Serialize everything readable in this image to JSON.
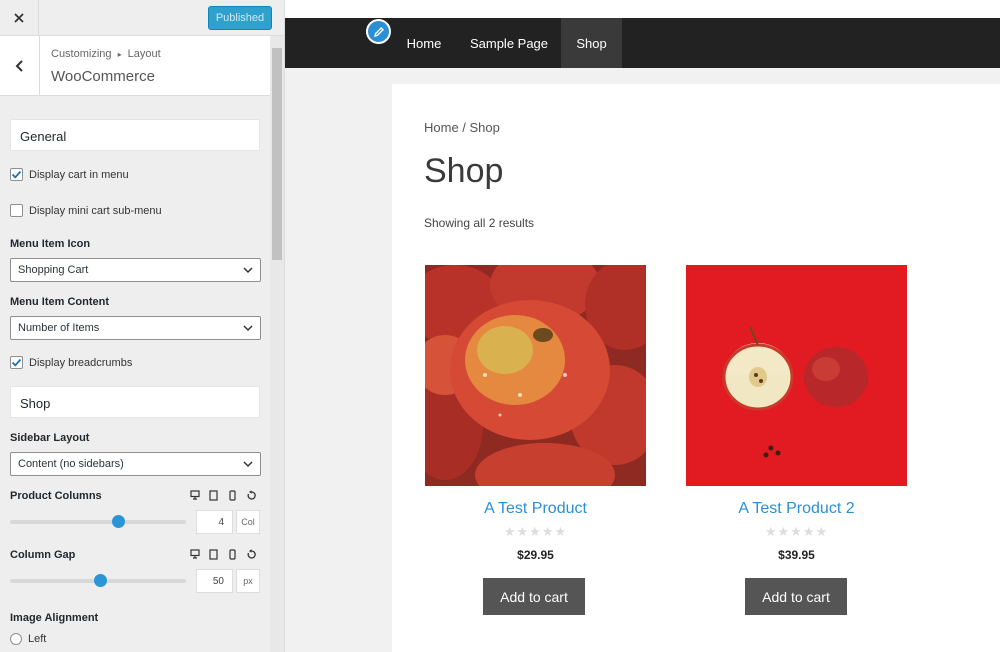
{
  "topbar": {
    "close_icon": "close-icon",
    "publish_label": "Published"
  },
  "section": {
    "breadcrumb_root": "Customizing",
    "breadcrumb_sep": "▸",
    "breadcrumb_parent": "Layout",
    "title": "WooCommerce"
  },
  "general": {
    "heading": "General",
    "display_cart_label": "Display cart in menu",
    "display_cart_checked": true,
    "mini_cart_label": "Display mini cart sub-menu",
    "mini_cart_checked": false,
    "menu_icon_label": "Menu Item Icon",
    "menu_icon_value": "Shopping Cart",
    "menu_content_label": "Menu Item Content",
    "menu_content_value": "Number of Items",
    "breadcrumbs_label": "Display breadcrumbs",
    "breadcrumbs_checked": true
  },
  "shop": {
    "heading": "Shop",
    "sidebar_layout_label": "Sidebar Layout",
    "sidebar_layout_value": "Content (no sidebars)",
    "product_columns_label": "Product Columns",
    "product_columns_value": "4",
    "product_columns_unit": "Col",
    "column_gap_label": "Column Gap",
    "column_gap_value": "50",
    "column_gap_unit": "px",
    "image_alignment_label": "Image Alignment",
    "image_alignment_option_left": "Left"
  },
  "colors": {
    "accent": "#2a8fd4",
    "nav_bg": "#222222",
    "button_bg": "#555555",
    "publish_bg": "#2ea2cc"
  },
  "nav": {
    "items": [
      "Home",
      "Sample Page",
      "Shop"
    ],
    "active": "Shop"
  },
  "page": {
    "breadcrumb": "Home / Shop",
    "title": "Shop",
    "result_count": "Showing all 2 results"
  },
  "products": [
    {
      "name": "A Test Product",
      "price": "$29.95",
      "rating_stars": "★★★★★",
      "button": "Add to cart"
    },
    {
      "name": "A Test Product 2",
      "price": "$39.95",
      "rating_stars": "★★★★★",
      "button": "Add to cart"
    }
  ]
}
